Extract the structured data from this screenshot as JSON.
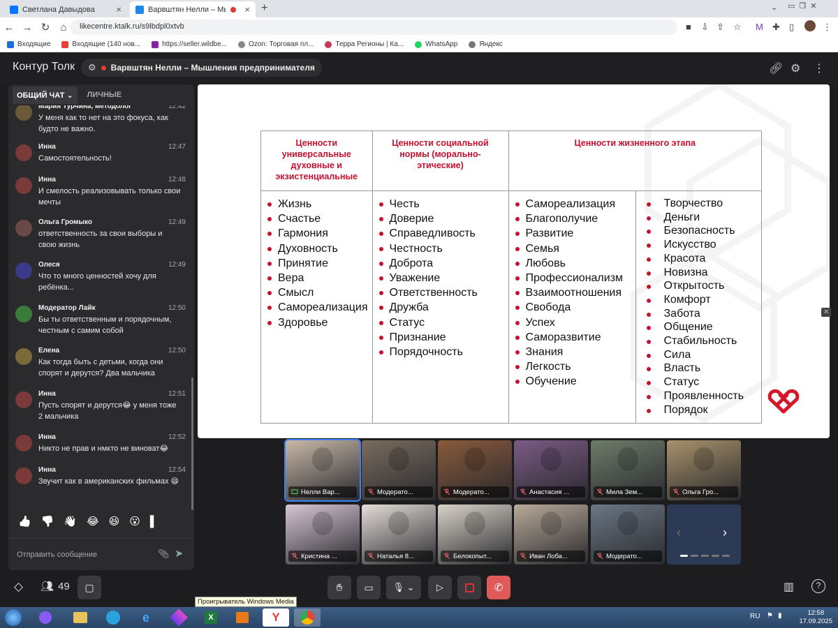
{
  "browser": {
    "tabs": [
      {
        "title": "Светлана Давыдова",
        "active": false
      },
      {
        "title": "Варвштян Нелли – Мышле",
        "active": true
      }
    ],
    "url": "likecentre.ktalk.ru/s9lbdpl0xtvb",
    "bookmarks": [
      "Входящие",
      "Входящие (140 нов...",
      "https://seller.wildbe...",
      "Ozon: Торговая пл...",
      "Терра Регионы | Ка...",
      "WhatsApp",
      "Яндекс"
    ]
  },
  "app": {
    "logo": "Контур Толк",
    "meeting_title": "Варвштян Нелли – Мышления предпринимателя",
    "participants_count": "49"
  },
  "chat": {
    "tabs": [
      "ОБЩИЙ ЧАТ",
      "ЛИЧНЫЕ"
    ],
    "messages": [
      {
        "name": "Мария Турчина, методолог",
        "time": "12:42",
        "text": "У меня как то нет на это фокуса, как будто не важно."
      },
      {
        "name": "Инна",
        "time": "12:47",
        "text": "Самостоятельность!"
      },
      {
        "name": "Инна",
        "time": "12:48",
        "text": "И смелость реализовывать только свои мечты"
      },
      {
        "name": "Ольга Громыко",
        "time": "12:49",
        "text": "ответственность за свои выборы и свою жизнь"
      },
      {
        "name": "Олеся",
        "time": "12:49",
        "text": "Что то много ценностей хочу для ребёнка..."
      },
      {
        "name": "Модератор Лайк",
        "time": "12:50",
        "text": "Бы ты ответственным и порядочным, честным с самим собой"
      },
      {
        "name": "Елена",
        "time": "12:50",
        "text": "Как тогда быть с детьми, когда они спорят и дерутся? Два мальчика"
      },
      {
        "name": "Инна",
        "time": "12:51",
        "text": "Пусть спорят и дерутся😂 у меня тоже 2 мальчика"
      },
      {
        "name": "Инна",
        "time": "12:52",
        "text": "Никто не прав и нмкто не виноват😂"
      },
      {
        "name": "Инна",
        "time": "12:54",
        "text": "Звучит как в американских фильмах 😄"
      }
    ],
    "reactions": [
      "👍",
      "👎",
      "👋",
      "😂",
      "😆",
      "😮",
      "▌"
    ],
    "input_placeholder": "Отправить сообщение"
  },
  "slide": {
    "headers": [
      "Ценности универсальные духовные и экзистенциальные",
      "Ценности социальной нормы (морально-этические)",
      "Ценности жизненного этапа"
    ],
    "col1": [
      "Жизнь",
      "Счастье",
      "Гармония",
      "Духовность",
      "Принятие",
      "Вера",
      "Смысл",
      "Самореализация",
      "Здоровье"
    ],
    "col2": [
      "Честь",
      "Доверие",
      "Справедливость",
      "Честность",
      "Доброта",
      "Уважение",
      "Ответственность",
      "Дружба",
      "Статус",
      "Признание",
      "Порядочность"
    ],
    "col3": [
      "Самореализация",
      "Благополучие",
      "Развитие",
      "Семья",
      "Любовь",
      "Профессионализм",
      "Взаимоотношения",
      "Свобода",
      "Успех",
      "Саморазвитие",
      "Знания",
      "Легкость",
      "Обучение"
    ],
    "col4": [
      "Творчество",
      "Деньги",
      "Безопасность",
      "Искусство",
      "Красота",
      "Новизна",
      "Открытость",
      "Комфорт",
      "Забота",
      "Общение",
      "Стабильность",
      "Сила",
      "Власть",
      "Статус",
      "Проявленность",
      "Порядок"
    ]
  },
  "videos": [
    {
      "name": "Нелли Вар...",
      "muted": false,
      "bg": "#c9b8a8"
    },
    {
      "name": "Модерато...",
      "muted": true,
      "bg": "#7a6c5f"
    },
    {
      "name": "Модерато...",
      "muted": true,
      "bg": "#8a5a3a"
    },
    {
      "name": "Анастасия ...",
      "muted": true,
      "bg": "#7b5a85"
    },
    {
      "name": "Мила Зем...",
      "muted": true,
      "bg": "#6e7d6a"
    },
    {
      "name": "Ольга Гро...",
      "muted": true,
      "bg": "#a8926a"
    },
    {
      "name": "Кристина ...",
      "muted": true,
      "bg": "#d8c6d6"
    },
    {
      "name": "Наталья 8...",
      "muted": true,
      "bg": "#e4ddd8"
    },
    {
      "name": "Белокопыт...",
      "muted": true,
      "bg": "#d8d2c8"
    },
    {
      "name": "Иван Лоба...",
      "muted": true,
      "bg": "#b9aa9a"
    },
    {
      "name": "Модерато...",
      "muted": true,
      "bg": "#6a7785"
    }
  ],
  "tooltip": "Проигрыватель Windows Media",
  "taskbar": {
    "lang": "RU",
    "time": "12:58",
    "date": "17.09.2025"
  }
}
